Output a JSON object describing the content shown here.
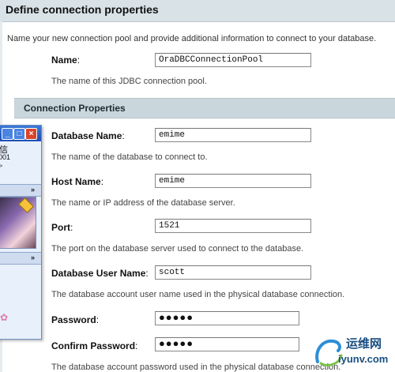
{
  "header": {
    "title": "Define connection properties"
  },
  "intro": "Name your new connection pool and provide additional information to connect to your database.",
  "name_field": {
    "label": "Name",
    "value": "OraDBCConnectionPool",
    "help": "The name of this JDBC connection pool."
  },
  "section": {
    "title": "Connection Properties"
  },
  "fields": [
    {
      "label": "Database Name",
      "value": "emime",
      "help": "The name of the database to connect to."
    },
    {
      "label": "Host Name",
      "value": "emime",
      "help": "The name or IP address of the database server."
    },
    {
      "label": "Port",
      "value": "1521",
      "help": "The port on the database server used to connect to the database."
    },
    {
      "label": "Database User Name",
      "value": "scott",
      "help": "The database account user name used in the physical database connection."
    },
    {
      "label": "Password",
      "value": "●●●●●"
    },
    {
      "label": "Confirm Password",
      "value": "●●●●●",
      "help": "The database account password used in the physical database connection."
    }
  ],
  "colon": ":",
  "chat_window": {
    "title_char": "信",
    "number": "001",
    "arrow": ">",
    "chevron": "»",
    "btn_min": "_",
    "btn_max": "□",
    "btn_close": "×",
    "deco": "✿"
  },
  "watermark": {
    "cn": "运维网",
    "url": "iyunv.com"
  },
  "colors": {
    "header_bg": "#d9e2e6",
    "section_bg": "#c9d6db",
    "chat_title": "#1b4fb3",
    "watermark": "#1a4f80"
  }
}
